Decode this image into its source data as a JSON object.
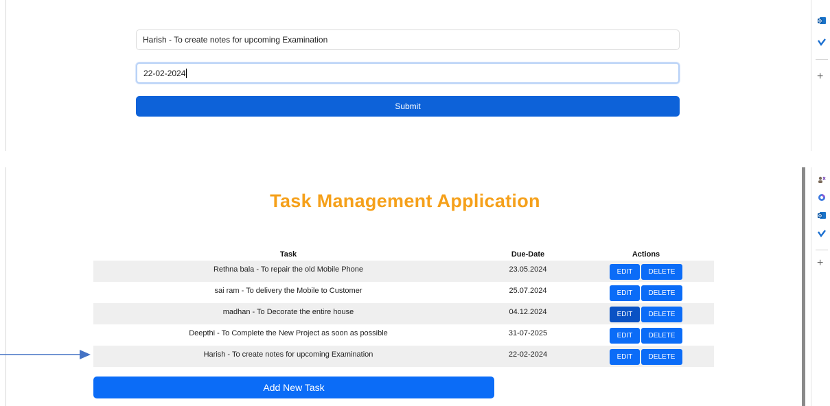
{
  "form": {
    "task_value": "Harish - To create notes for upcoming Examination",
    "date_value": "22-02-2024",
    "submit_label": "Submit"
  },
  "app": {
    "title": "Task Management Application"
  },
  "table": {
    "headers": {
      "task": "Task",
      "due": "Due-Date",
      "actions": "Actions"
    },
    "rows": [
      {
        "task": "Rethna bala - To repair the old Mobile Phone",
        "due": "23.05.2024"
      },
      {
        "task": "sai ram - To delivery the Mobile to Customer",
        "due": "25.07.2024"
      },
      {
        "task": "madhan - To Decorate the entire house",
        "due": "04.12.2024"
      },
      {
        "task": "Deepthi - To Complete the New Project as soon as possible",
        "due": "31-07-2025"
      },
      {
        "task": "Harish - To create notes for upcoming Examination",
        "due": "22-02-2024"
      }
    ],
    "edit_label": "EDIT",
    "delete_label": "DELETE"
  },
  "add_button_label": "Add New Task",
  "rail_icons": [
    "outlook-icon",
    "todo-icon",
    "people-icon",
    "copilot-icon"
  ],
  "colors": {
    "title": "#f5a01a",
    "primary": "#0b6cf7",
    "submit": "#0d62d9",
    "row_alt": "#efefef",
    "arrow": "#4472c4"
  }
}
